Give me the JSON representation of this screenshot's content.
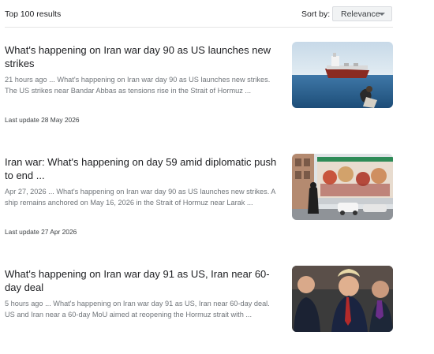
{
  "header": {
    "results_count": "Top 100 results",
    "sort_label": "Sort by:",
    "sort_value": "Relevance"
  },
  "results": [
    {
      "title": "What's happening on Iran war day 90 as US launches new strikes",
      "snippet": "21 hours ago ... What's happening on Iran war day 90 as US launches new strikes. The US strikes near Bandar Abbas as tensions rise in the Strait of Hormuz ...",
      "last_update": "Last update 28 May 2026",
      "thumbnail_icon": "ship-at-sea-image"
    },
    {
      "title": "Iran war: What's happening on day 59 amid diplomatic push to end ...",
      "snippet": "Apr 27, 2026 ... What's happening on Iran war day 90 as US launches new strikes. A ship remains anchored on May 16, 2026 in the Strait of Hormuz near Larak ...",
      "last_update": "Last update 27 Apr 2026",
      "thumbnail_icon": "street-mural-image"
    },
    {
      "title": "What's happening on Iran war day 91 as US, Iran near 60-day deal",
      "snippet": "5 hours ago ... What's happening on Iran war day 91 as US, Iran near 60-day deal. US and Iran near a 60-day MoU aimed at reopening the Hormuz strait with ...",
      "last_update": "",
      "thumbnail_icon": "officials-meeting-image"
    }
  ]
}
